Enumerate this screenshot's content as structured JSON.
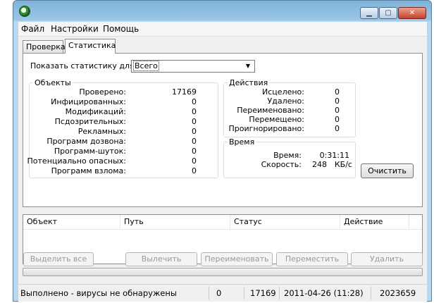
{
  "window": {
    "title": ""
  },
  "menu": {
    "items": [
      "Файл",
      "Настройки",
      "Помощь"
    ]
  },
  "tabs": [
    {
      "label": "Проверка"
    },
    {
      "label": "Статистика"
    }
  ],
  "stats_filter": {
    "label": "Показать статистику для:",
    "value": "Всего"
  },
  "objects": {
    "title": "Объекты",
    "rows": [
      {
        "label": "Проверено:",
        "value": "17169"
      },
      {
        "label": "Инфицированных:",
        "value": "0"
      },
      {
        "label": "Модификаций:",
        "value": "0"
      },
      {
        "label": "Псдозрительных:",
        "value": "0"
      },
      {
        "label": "Рекламных:",
        "value": "0"
      },
      {
        "label": "Программ дозвона:",
        "value": "0"
      },
      {
        "label": "Программ-шуток:",
        "value": "0"
      },
      {
        "label": "Потенциально опасных:",
        "value": "0"
      },
      {
        "label": "Программ взлома:",
        "value": "0"
      }
    ]
  },
  "actions": {
    "title": "Действия",
    "rows": [
      {
        "label": "Исцелено:",
        "value": "0"
      },
      {
        "label": "Удалено:",
        "value": "0"
      },
      {
        "label": "Переименовано:",
        "value": "0"
      },
      {
        "label": "Перемещено:",
        "value": "0"
      },
      {
        "label": "Проигнорировано:",
        "value": "0"
      }
    ]
  },
  "time": {
    "title": "Время",
    "rows": [
      {
        "label": "Время:",
        "value": "0:31:11",
        "unit": ""
      },
      {
        "label": "Скорость:",
        "value": "248",
        "unit": "КБ/с"
      }
    ]
  },
  "clear_button": "Очистить",
  "table": {
    "columns": [
      "Объект",
      "Путь",
      "Статус",
      "Действие"
    ],
    "rows": []
  },
  "buttons": {
    "select_all": "Выделить все",
    "cure": "Вылечить",
    "rename": "Переименовать",
    "move": "Переместить",
    "delete": "Удалить"
  },
  "progress": {
    "percent": 0
  },
  "status": {
    "message": "Выполнено - вирусы не обнаружены",
    "infected": "0",
    "checked": "17169",
    "datetime": "2011-04-26 (11:28)",
    "db_records": "2023659"
  }
}
